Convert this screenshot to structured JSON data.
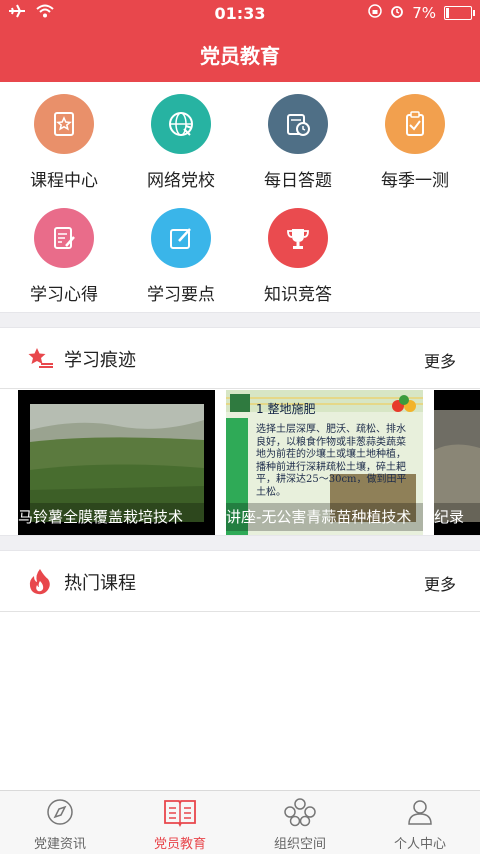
{
  "status_bar": {
    "time": "01:33",
    "battery": "7%"
  },
  "header": {
    "title": "党员教育"
  },
  "menu": [
    {
      "label": "课程中心",
      "color": "#e9906a",
      "icon": "book-star-icon"
    },
    {
      "label": "网络党校",
      "color": "#27b3a2",
      "icon": "globe-party-icon"
    },
    {
      "label": "每日答题",
      "color": "#4f6f86",
      "icon": "calendar-clock-icon"
    },
    {
      "label": "每季一测",
      "color": "#f2a04e",
      "icon": "clipboard-check-icon"
    },
    {
      "label": "学习心得",
      "color": "#e96c8a",
      "icon": "notes-pen-icon"
    },
    {
      "label": "学习要点",
      "color": "#3ab5e9",
      "icon": "edit-icon"
    },
    {
      "label": "知识竞答",
      "color": "#ea4b4f",
      "icon": "trophy-icon"
    }
  ],
  "study_section": {
    "title": "学习痕迹",
    "more": "更多"
  },
  "study_cards": [
    {
      "caption": "马铃薯全膜覆盖栽培技术"
    },
    {
      "caption": "讲座-无公害青蒜苗种植技术",
      "slide_heading": "1 整地施肥",
      "slide_text": "选择土层深厚、肥沃、疏松、排水良好，以粮食作物或非葱蒜类蔬菜地为前茬的沙壤土或壤土地种植，播种前进行深耕疏松土壤，碎土耙平，耕深达25～30cm，做到田平土松。"
    },
    {
      "caption": "纪录"
    }
  ],
  "hot_section": {
    "title": "热门课程",
    "more": "更多"
  },
  "tabs": [
    {
      "label": "党建资讯",
      "icon": "news-icon",
      "active": false
    },
    {
      "label": "党员教育",
      "icon": "education-book-icon",
      "active": true
    },
    {
      "label": "组织空间",
      "icon": "organization-icon",
      "active": false
    },
    {
      "label": "个人中心",
      "icon": "person-icon",
      "active": false
    }
  ]
}
